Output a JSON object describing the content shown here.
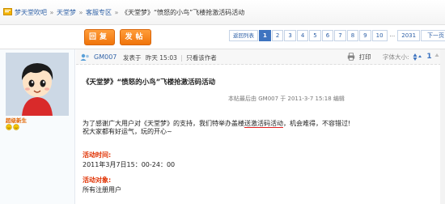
{
  "breadcrumb": {
    "items": [
      "梦天堂吹吧",
      "天堂梦",
      "客服专区",
      "《天堂梦》“愤怒的小鸟”飞楼抢激活码活动"
    ],
    "separator": "»"
  },
  "toolbar": {
    "reply_label": "回复",
    "post_label": "发帖"
  },
  "pager": {
    "back_label": "返回列表",
    "pages": [
      "1",
      "2",
      "3",
      "4",
      "5",
      "6",
      "7",
      "8",
      "9",
      "10"
    ],
    "current": "1",
    "ellipsis": "...",
    "last": "2031",
    "next_label": "下一页"
  },
  "author_panel": {
    "rank": "超级新生"
  },
  "post": {
    "author": "GM007",
    "posted_label": "发表于",
    "posted_time": "昨天 15:03",
    "only_author": "只看该作者",
    "print_label": "打印",
    "font_label": "字体大小:",
    "post_number": "1",
    "title": "《天堂梦》“愤怒的小鸟”飞楼抢激活码活动",
    "edit_note": "本帖最后由  GM007  于  2011-3-7 15:18  编辑",
    "body_line1_a": "为了感谢广大用户对《天堂梦》的支持，我们特举办盖楼",
    "body_line1_b": "送激活码活动",
    "body_line1_c": "，机会难得，不容错过!",
    "body_line2": "祝大家都有好运气，玩的开心~",
    "time_label": "活动时间:",
    "time_value": "2011年3月7日15：00-24：00",
    "target_label": "活动对象:",
    "target_value": "所有注册用户"
  },
  "colors": {
    "accent_orange": "#f0740a",
    "link_blue": "#3364a8",
    "pager_current": "#3e74c0",
    "section_red": "#e03000"
  }
}
